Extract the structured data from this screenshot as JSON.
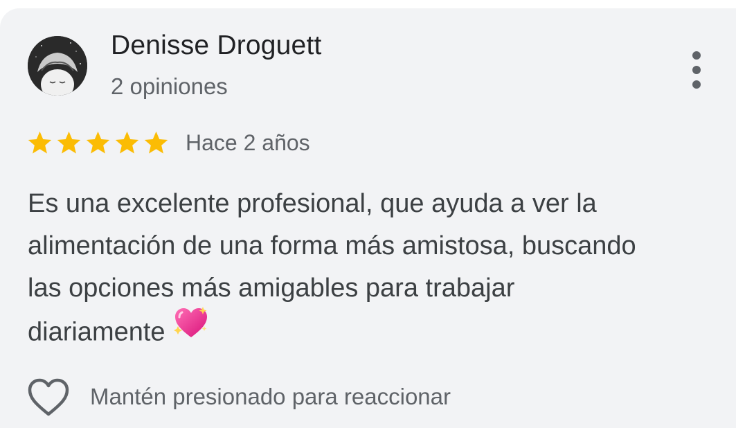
{
  "review": {
    "author": {
      "name": "Denisse Droguett",
      "review_count": "2 opiniones",
      "avatar_icon": "user-avatar"
    },
    "rating": {
      "stars": 5,
      "max_stars": 5,
      "star_color": "#fbbc04"
    },
    "date": "Hace 2 años",
    "text_lines": [
      "Es una excelente profesional, que ayuda a ver la",
      "alimentación de una forma más amistosa, buscando",
      "las opciones más amigables para trabajar",
      "diariamente"
    ],
    "emoji_icon": "sparkling-heart-icon",
    "menu_icon": "more-vertical-icon",
    "reaction": {
      "icon": "heart-outline-icon",
      "hint": "Mantén presionado para reaccionar"
    }
  },
  "colors": {
    "card_background": "#f2f3f5",
    "primary_text": "#202124",
    "secondary_text": "#5f6368",
    "body_text": "#3c4043",
    "icon_color": "#5f6368"
  }
}
